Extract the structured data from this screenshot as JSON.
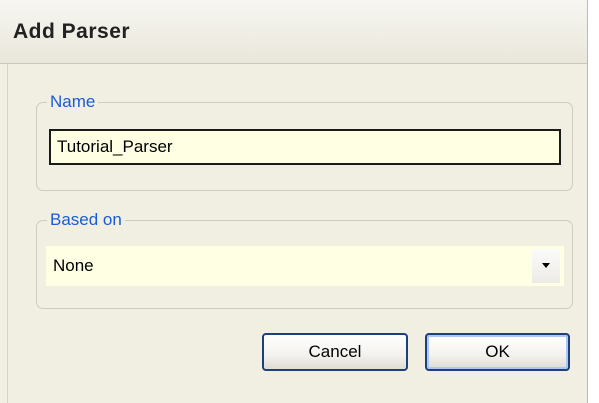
{
  "dialog": {
    "title": "Add Parser"
  },
  "name_group": {
    "legend": "Name",
    "input_value": "Tutorial_Parser"
  },
  "based_on_group": {
    "legend": "Based on",
    "selected_value": "None",
    "arrow_icon": "chevron-down-icon"
  },
  "buttons": {
    "cancel_label": "Cancel",
    "ok_label": "OK"
  }
}
